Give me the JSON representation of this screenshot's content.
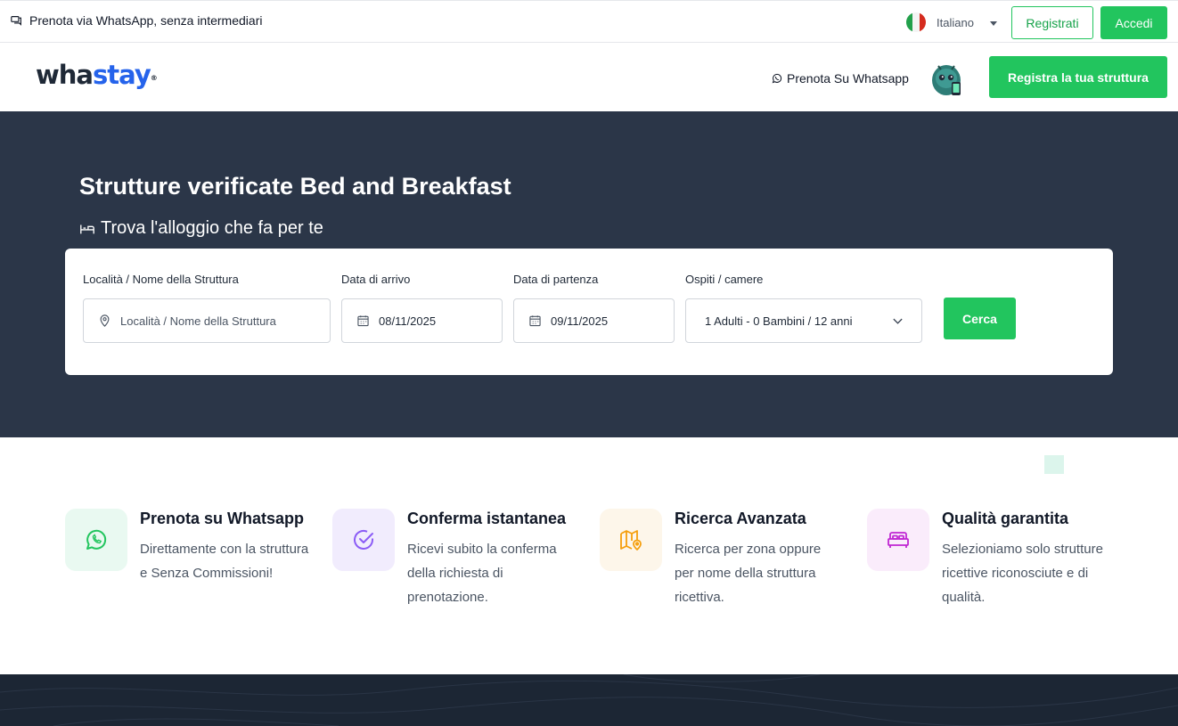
{
  "topbar": {
    "promo_text": "Prenota via WhatsApp, senza intermediari",
    "language": "Italiano",
    "register_label": "Registrati",
    "login_label": "Accedi"
  },
  "header": {
    "logo_part1": "wha",
    "logo_part2": "stay",
    "logo_mark": "®",
    "whatsapp_link": "Prenota Su Whatsapp",
    "register_property_label": "Registra la tua struttura"
  },
  "hero": {
    "title": "Strutture verificate Bed and Breakfast",
    "subtitle": "Trova l'alloggio che fa per te"
  },
  "search": {
    "location_label": "Località / Nome della Struttura",
    "location_placeholder": "Località / Nome della Struttura",
    "arrival_label": "Data di arrivo",
    "arrival_value": "08/11/2025",
    "departure_label": "Data di partenza",
    "departure_value": "09/11/2025",
    "guests_label": "Ospiti / camere",
    "guests_value": "1 Adulti - 0 Bambini / 12 anni",
    "search_button": "Cerca"
  },
  "features": [
    {
      "title": "Prenota su Whatsapp",
      "desc": "Direttamente con la struttura e Senza Commissioni!",
      "icon": "whatsapp-icon",
      "color": "#22c55e",
      "bg": "#e9f9f1"
    },
    {
      "title": "Conferma istantanea",
      "desc": "Ricevi subito la conferma della richiesta di prenotazione.",
      "icon": "check-circle-icon",
      "color": "#8b5cf6",
      "bg": "#f1ecfd"
    },
    {
      "title": "Ricerca Avanzata",
      "desc": "Ricerca per zona oppure per nome della struttura ricettiva.",
      "icon": "map-pin-icon",
      "color": "#f59e0b",
      "bg": "#fdf6ea"
    },
    {
      "title": "Qualità garantita",
      "desc": "Selezioniamo solo strutture ricettive riconosciute e di qualità.",
      "icon": "bed-icon",
      "color": "#c026d3",
      "bg": "#faecfb"
    }
  ]
}
